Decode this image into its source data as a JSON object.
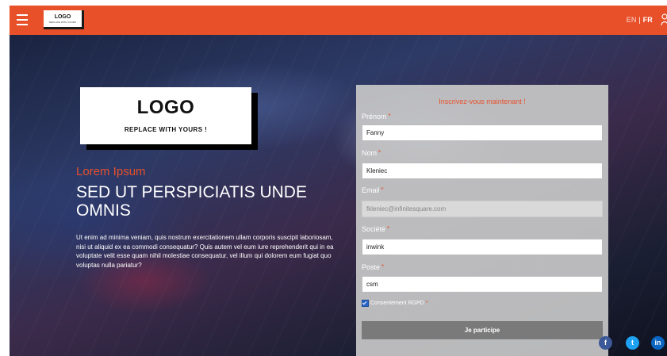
{
  "header": {
    "logo": {
      "title": "LOGO",
      "subtitle": "REPLACE WITH YOURS"
    },
    "lang_en": "EN",
    "lang_sep": " | ",
    "lang_fr": "FR"
  },
  "hero": {
    "logo_title": "LOGO",
    "logo_subtitle": "REPLACE WITH YOURS !",
    "kicker": "Lorem Ipsum",
    "headline": "SED UT PERSPICIATIS UNDE OMNIS",
    "body": "Ut enim ad minima veniam, quis nostrum exercitationem ullam corporis suscipit laboriosam, nisi ut aliquid ex ea commodi consequatur? Quis autem vel eum iure reprehenderit qui in ea voluptate velit esse quam nihil molestiae consequatur, vel illum qui dolorem eum fugiat quo voluptas nulla pariatur?"
  },
  "form": {
    "title": "Inscrivez-vous maintenant !",
    "required_mark": "*",
    "fields": [
      {
        "label": "Prénom",
        "value": "Fanny",
        "disabled": false
      },
      {
        "label": "Nom",
        "value": "Kleniec",
        "disabled": false
      },
      {
        "label": "Email",
        "value": "fkleniec@infinitesquare.com",
        "disabled": true
      },
      {
        "label": "Société",
        "value": "inwink",
        "disabled": false
      },
      {
        "label": "Poste",
        "value": "csm",
        "disabled": false
      }
    ],
    "consent_label": "Consentement RGPD",
    "consent_checked": true,
    "submit_label": "Je participe"
  },
  "social": {
    "facebook": "f",
    "twitter": "t",
    "linkedin": "in"
  },
  "colors": {
    "accent": "#e8502a",
    "header_bg": "#e8502a",
    "button_bg": "#7a7a7a",
    "panel_bg": "#c8c8c8"
  }
}
